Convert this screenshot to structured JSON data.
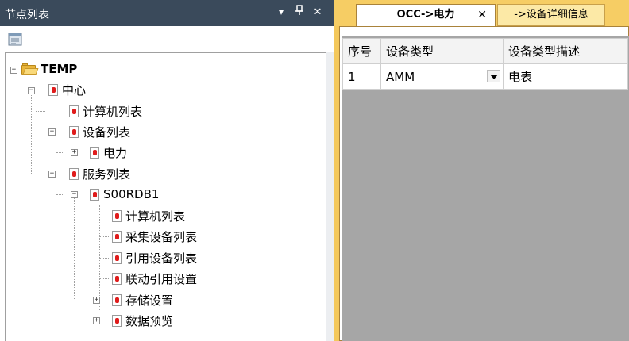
{
  "left_panel": {
    "title": "节点列表",
    "buttons": {
      "dropdown": "▾",
      "pin": "ᵖ",
      "close": "✕"
    },
    "toolbar_icon": "properties-icon",
    "tree": [
      {
        "label": "TEMP",
        "icon": "folder-open-icon"
      },
      {
        "label": "中心",
        "icon": "doc-icon"
      },
      {
        "label": "计算机列表",
        "icon": "doc-icon"
      },
      {
        "label": "设备列表",
        "icon": "doc-icon"
      },
      {
        "label": "电力",
        "icon": "doc-icon"
      },
      {
        "label": "服务列表",
        "icon": "doc-icon"
      },
      {
        "label": "S00RDB1",
        "icon": "doc-icon"
      },
      {
        "label": "计算机列表",
        "icon": "doc-icon"
      },
      {
        "label": "采集设备列表",
        "icon": "doc-icon"
      },
      {
        "label": "引用设备列表",
        "icon": "doc-icon"
      },
      {
        "label": "联动引用设置",
        "icon": "doc-icon"
      },
      {
        "label": "存储设置",
        "icon": "doc-icon"
      },
      {
        "label": "数据预览",
        "icon": "doc-icon"
      }
    ],
    "expanders": {
      "expanded": "−",
      "collapsed": "+"
    }
  },
  "right_panel": {
    "tabs": [
      {
        "label": "OCC->电力",
        "close": "✕",
        "active": true
      },
      {
        "label": "->设备详细信息",
        "active": false
      }
    ],
    "grid": {
      "columns": [
        "序号",
        "设备类型",
        "设备类型描述"
      ],
      "rows": [
        {
          "index": "1",
          "type": "AMM",
          "description": "电表"
        }
      ]
    }
  },
  "colors": {
    "header_bg": "#3a4a5b",
    "tab_strip": "#f6cd64",
    "grid_bg": "#a6a6a6",
    "node_icon_red": "#e01c1c"
  }
}
